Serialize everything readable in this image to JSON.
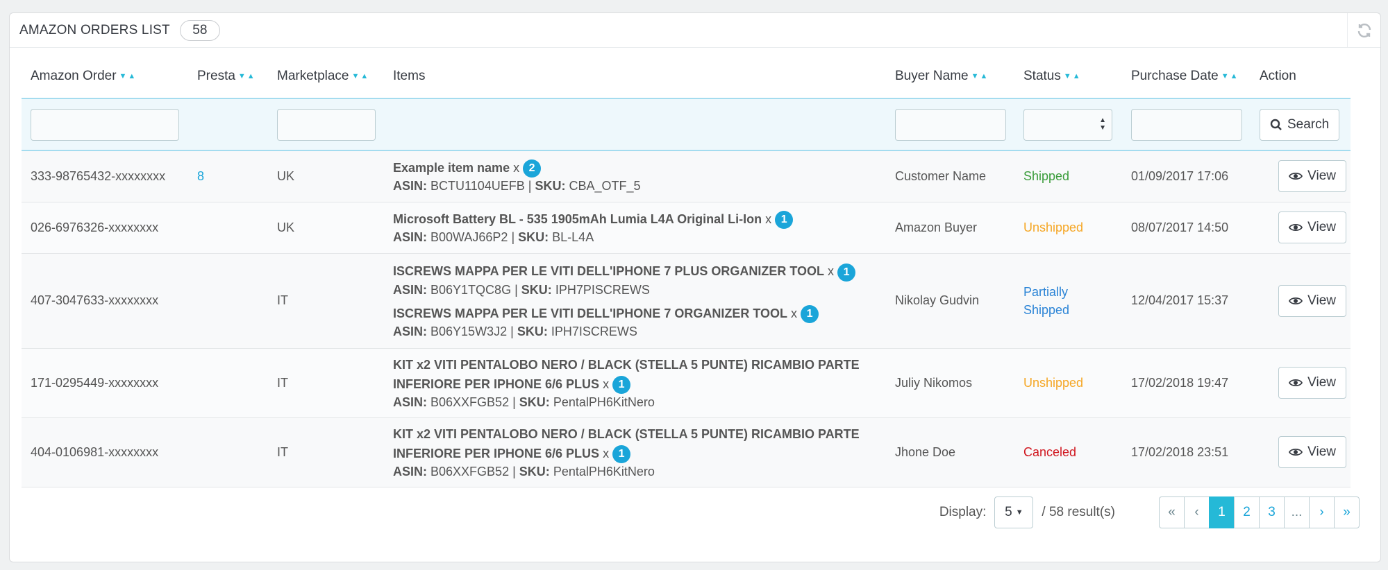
{
  "header": {
    "title": "AMAZON ORDERS LIST",
    "count": "58"
  },
  "columns": {
    "amazon_order": "Amazon Order",
    "presta": "Presta",
    "marketplace": "Marketplace",
    "items": "Items",
    "buyer_name": "Buyer Name",
    "status": "Status",
    "purchase_date": "Purchase Date",
    "action": "Action"
  },
  "filters": {
    "search_label": "Search"
  },
  "rows": [
    {
      "order": "333-98765432-xxxxxxxx",
      "presta": "8",
      "marketplace": "UK",
      "items": [
        {
          "name": "Example item name",
          "qty": "2",
          "asin": "BCTU1104UEFB",
          "sku": "CBA_OTF_5"
        }
      ],
      "buyer": "Customer Name",
      "status": "Shipped",
      "date": "01/09/2017 17:06",
      "action": "View"
    },
    {
      "order": "026-6976326-xxxxxxxx",
      "presta": "",
      "marketplace": "UK",
      "items": [
        {
          "name": "Microsoft Battery BL - 535 1905mAh Lumia L4A Original Li-Ion",
          "qty": "1",
          "asin": "B00WAJ66P2",
          "sku": "BL-L4A"
        }
      ],
      "buyer": "Amazon Buyer",
      "status": "Unshipped",
      "date": "08/07/2017 14:50",
      "action": "View"
    },
    {
      "order": "407-3047633-xxxxxxxx",
      "presta": "",
      "marketplace": "IT",
      "items": [
        {
          "name": "ISCREWS MAPPA PER LE VITI DELL'IPHONE 7 PLUS ORGANIZER TOOL",
          "qty": "1",
          "asin": "B06Y1TQC8G",
          "sku": "IPH7PISCREWS"
        },
        {
          "name": "ISCREWS MAPPA PER LE VITI DELL'IPHONE 7 ORGANIZER TOOL",
          "qty": "1",
          "asin": "B06Y15W3J2",
          "sku": "IPH7ISCREWS"
        }
      ],
      "buyer": "Nikolay Gudvin",
      "status": "Partially Shipped",
      "date": "12/04/2017 15:37",
      "action": "View"
    },
    {
      "order": "171-0295449-xxxxxxxx",
      "presta": "",
      "marketplace": "IT",
      "items": [
        {
          "name": "KIT x2 VITI PENTALOBO NERO / BLACK (STELLA 5 PUNTE) RICAMBIO PARTE INFERIORE PER IPHONE 6/6 PLUS",
          "qty": "1",
          "asin": "B06XXFGB52",
          "sku": "PentalPH6KitNero"
        }
      ],
      "buyer": "Juliy Nikomos",
      "status": "Unshipped",
      "date": "17/02/2018 19:47",
      "action": "View"
    },
    {
      "order": "404-0106981-xxxxxxxx",
      "presta": "",
      "marketplace": "IT",
      "items": [
        {
          "name": "KIT x2 VITI PENTALOBO NERO / BLACK (STELLA 5 PUNTE) RICAMBIO PARTE INFERIORE PER IPHONE 6/6 PLUS",
          "qty": "1",
          "asin": "B06XXFGB52",
          "sku": "PentalPH6KitNero"
        }
      ],
      "buyer": "Jhone Doe",
      "status": "Canceled",
      "date": "17/02/2018 23:51",
      "action": "View"
    }
  ],
  "labels": {
    "asin": "ASIN:",
    "sku": "SKU:",
    "times": "x",
    "sep": "|"
  },
  "footer": {
    "display_label": "Display:",
    "display_value": "5",
    "results": "/ 58 result(s)",
    "pages": [
      "1",
      "2",
      "3",
      "..."
    ],
    "current_page": "1"
  },
  "colors": {
    "accent": "#25b9d7",
    "shipped": "#3a9c3a",
    "unshipped": "#f5a623",
    "partial": "#2b84d6",
    "canceled": "#d0171f"
  }
}
